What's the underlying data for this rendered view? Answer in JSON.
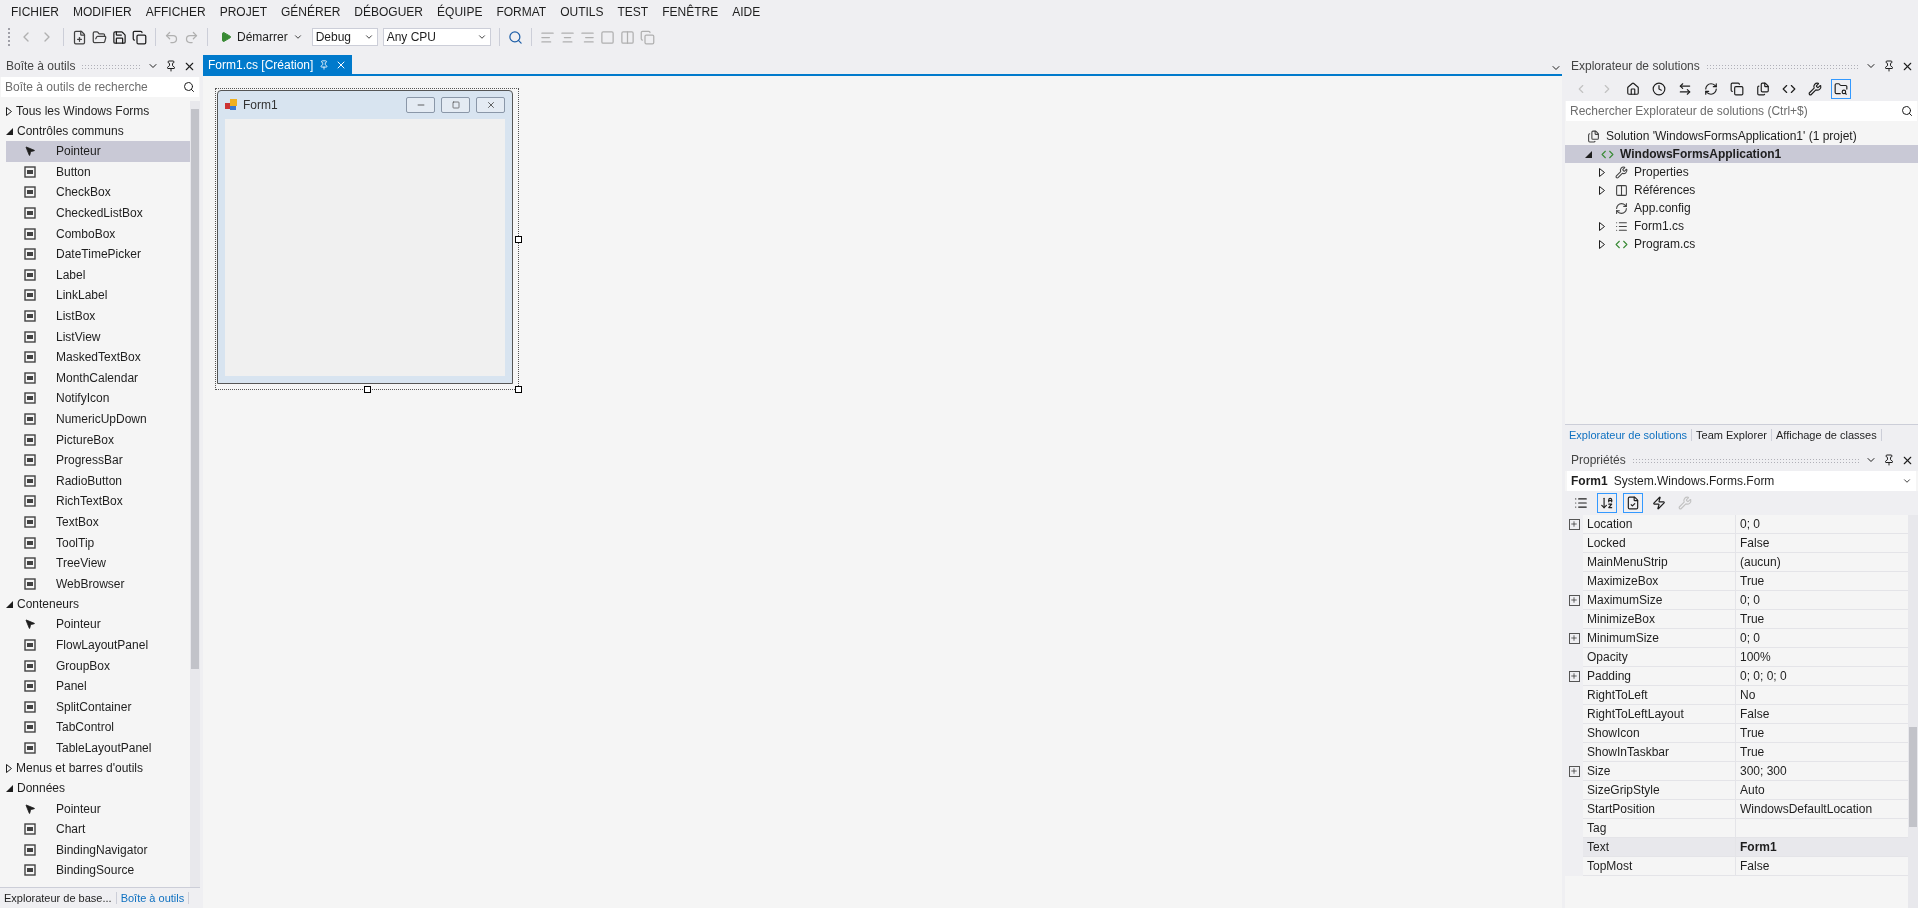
{
  "menu": [
    "FICHIER",
    "MODIFIER",
    "AFFICHER",
    "PROJET",
    "GÉNÉRER",
    "DÉBOGUER",
    "ÉQUIPE",
    "FORMAT",
    "OUTILS",
    "TEST",
    "FENÊTRE",
    "AIDE"
  ],
  "toolbar": {
    "start_label": "Démarrer",
    "configuration": "Debug",
    "platform": "Any CPU"
  },
  "toolbox": {
    "title": "Boîte à outils",
    "search_placeholder": "Boîte à outils de recherche",
    "groups": [
      {
        "label": "Tous les Windows Forms",
        "expanded": false
      },
      {
        "label": "Contrôles communs",
        "expanded": true,
        "children": [
          {
            "label": "Pointeur",
            "kind": "pointer",
            "selected": true
          },
          {
            "label": "Button",
            "kind": "control",
            "selected": false
          },
          {
            "label": "CheckBox",
            "kind": "control",
            "selected": false
          },
          {
            "label": "CheckedListBox",
            "kind": "control",
            "selected": false
          },
          {
            "label": "ComboBox",
            "kind": "control",
            "selected": false
          },
          {
            "label": "DateTimePicker",
            "kind": "control",
            "selected": false
          },
          {
            "label": "Label",
            "kind": "control",
            "selected": false
          },
          {
            "label": "LinkLabel",
            "kind": "control",
            "selected": false
          },
          {
            "label": "ListBox",
            "kind": "control",
            "selected": false
          },
          {
            "label": "ListView",
            "kind": "control",
            "selected": false
          },
          {
            "label": "MaskedTextBox",
            "kind": "control",
            "selected": false
          },
          {
            "label": "MonthCalendar",
            "kind": "control",
            "selected": false
          },
          {
            "label": "NotifyIcon",
            "kind": "control",
            "selected": false
          },
          {
            "label": "NumericUpDown",
            "kind": "control",
            "selected": false
          },
          {
            "label": "PictureBox",
            "kind": "control",
            "selected": false
          },
          {
            "label": "ProgressBar",
            "kind": "control",
            "selected": false
          },
          {
            "label": "RadioButton",
            "kind": "control",
            "selected": false
          },
          {
            "label": "RichTextBox",
            "kind": "control",
            "selected": false
          },
          {
            "label": "TextBox",
            "kind": "control",
            "selected": false
          },
          {
            "label": "ToolTip",
            "kind": "control",
            "selected": false
          },
          {
            "label": "TreeView",
            "kind": "control",
            "selected": false
          },
          {
            "label": "WebBrowser",
            "kind": "control",
            "selected": false
          }
        ]
      },
      {
        "label": "Conteneurs",
        "expanded": true,
        "children": [
          {
            "label": "Pointeur",
            "kind": "pointer",
            "selected": false
          },
          {
            "label": "FlowLayoutPanel",
            "kind": "control",
            "selected": false
          },
          {
            "label": "GroupBox",
            "kind": "control",
            "selected": false
          },
          {
            "label": "Panel",
            "kind": "control",
            "selected": false
          },
          {
            "label": "SplitContainer",
            "kind": "control",
            "selected": false
          },
          {
            "label": "TabControl",
            "kind": "control",
            "selected": false
          },
          {
            "label": "TableLayoutPanel",
            "kind": "control",
            "selected": false
          }
        ]
      },
      {
        "label": "Menus et barres d'outils",
        "expanded": false
      },
      {
        "label": "Données",
        "expanded": true,
        "children": [
          {
            "label": "Pointeur",
            "kind": "pointer",
            "selected": false
          },
          {
            "label": "Chart",
            "kind": "control",
            "selected": false
          },
          {
            "label": "BindingNavigator",
            "kind": "control",
            "selected": false
          },
          {
            "label": "BindingSource",
            "kind": "control",
            "selected": false
          }
        ]
      }
    ],
    "tabs": [
      {
        "label": "Explorateur de base...",
        "selected": false
      },
      {
        "label": "Boîte à outils",
        "selected": true
      }
    ]
  },
  "editor": {
    "tabs": [
      {
        "label": "Form1.cs [Création]",
        "selected": true
      }
    ],
    "form": {
      "title": "Form1"
    }
  },
  "solution_explorer": {
    "title": "Explorateur de solutions",
    "search_placeholder": "Rechercher Explorateur de solutions (Ctrl+$)",
    "tree": [
      {
        "label": "Solution 'WindowsFormsApplication1' (1 projet)",
        "kind": "solution",
        "selected": false,
        "children": [
          {
            "label": "WindowsFormsApplication1",
            "kind": "project",
            "selected": true,
            "expanded": true,
            "children": [
              {
                "label": "Properties",
                "kind": "wrench",
                "selected": false,
                "expanded": false
              },
              {
                "label": "Références",
                "kind": "references",
                "selected": false,
                "expanded": false
              },
              {
                "label": "App.config",
                "kind": "config",
                "selected": false
              },
              {
                "label": "Form1.cs",
                "kind": "form",
                "selected": false,
                "expanded": false
              },
              {
                "label": "Program.cs",
                "kind": "csharp",
                "selected": false,
                "expanded": false
              }
            ]
          }
        ]
      }
    ],
    "tabs": [
      {
        "label": "Explorateur de solutions",
        "selected": true
      },
      {
        "label": "Team Explorer",
        "selected": false
      },
      {
        "label": "Affichage de classes",
        "selected": false
      }
    ]
  },
  "properties": {
    "title": "Propriétés",
    "object_name": "Form1",
    "object_type": "System.Windows.Forms.Form",
    "rows": [
      {
        "name": "Location",
        "value": "0; 0",
        "expandable": true,
        "modified": false,
        "selected": false
      },
      {
        "name": "Locked",
        "value": "False",
        "expandable": false,
        "modified": false,
        "selected": false
      },
      {
        "name": "MainMenuStrip",
        "value": "(aucun)",
        "expandable": false,
        "modified": false,
        "selected": false
      },
      {
        "name": "MaximizeBox",
        "value": "True",
        "expandable": false,
        "modified": false,
        "selected": false
      },
      {
        "name": "MaximumSize",
        "value": "0; 0",
        "expandable": true,
        "modified": false,
        "selected": false
      },
      {
        "name": "MinimizeBox",
        "value": "True",
        "expandable": false,
        "modified": false,
        "selected": false
      },
      {
        "name": "MinimumSize",
        "value": "0; 0",
        "expandable": true,
        "modified": false,
        "selected": false
      },
      {
        "name": "Opacity",
        "value": "100%",
        "expandable": false,
        "modified": false,
        "selected": false
      },
      {
        "name": "Padding",
        "value": "0; 0; 0; 0",
        "expandable": true,
        "modified": false,
        "selected": false
      },
      {
        "name": "RightToLeft",
        "value": "No",
        "expandable": false,
        "modified": false,
        "selected": false
      },
      {
        "name": "RightToLeftLayout",
        "value": "False",
        "expandable": false,
        "modified": false,
        "selected": false
      },
      {
        "name": "ShowIcon",
        "value": "True",
        "expandable": false,
        "modified": false,
        "selected": false
      },
      {
        "name": "ShowInTaskbar",
        "value": "True",
        "expandable": false,
        "modified": false,
        "selected": false
      },
      {
        "name": "Size",
        "value": "300; 300",
        "expandable": true,
        "modified": false,
        "selected": false
      },
      {
        "name": "SizeGripStyle",
        "value": "Auto",
        "expandable": false,
        "modified": false,
        "selected": false
      },
      {
        "name": "StartPosition",
        "value": "WindowsDefaultLocation",
        "expandable": false,
        "modified": false,
        "selected": false
      },
      {
        "name": "Tag",
        "value": "",
        "expandable": false,
        "modified": false,
        "selected": false
      },
      {
        "name": "Text",
        "value": "Form1",
        "expandable": false,
        "modified": true,
        "selected": true
      },
      {
        "name": "TopMost",
        "value": "False",
        "expandable": false,
        "modified": false,
        "selected": false
      }
    ]
  }
}
